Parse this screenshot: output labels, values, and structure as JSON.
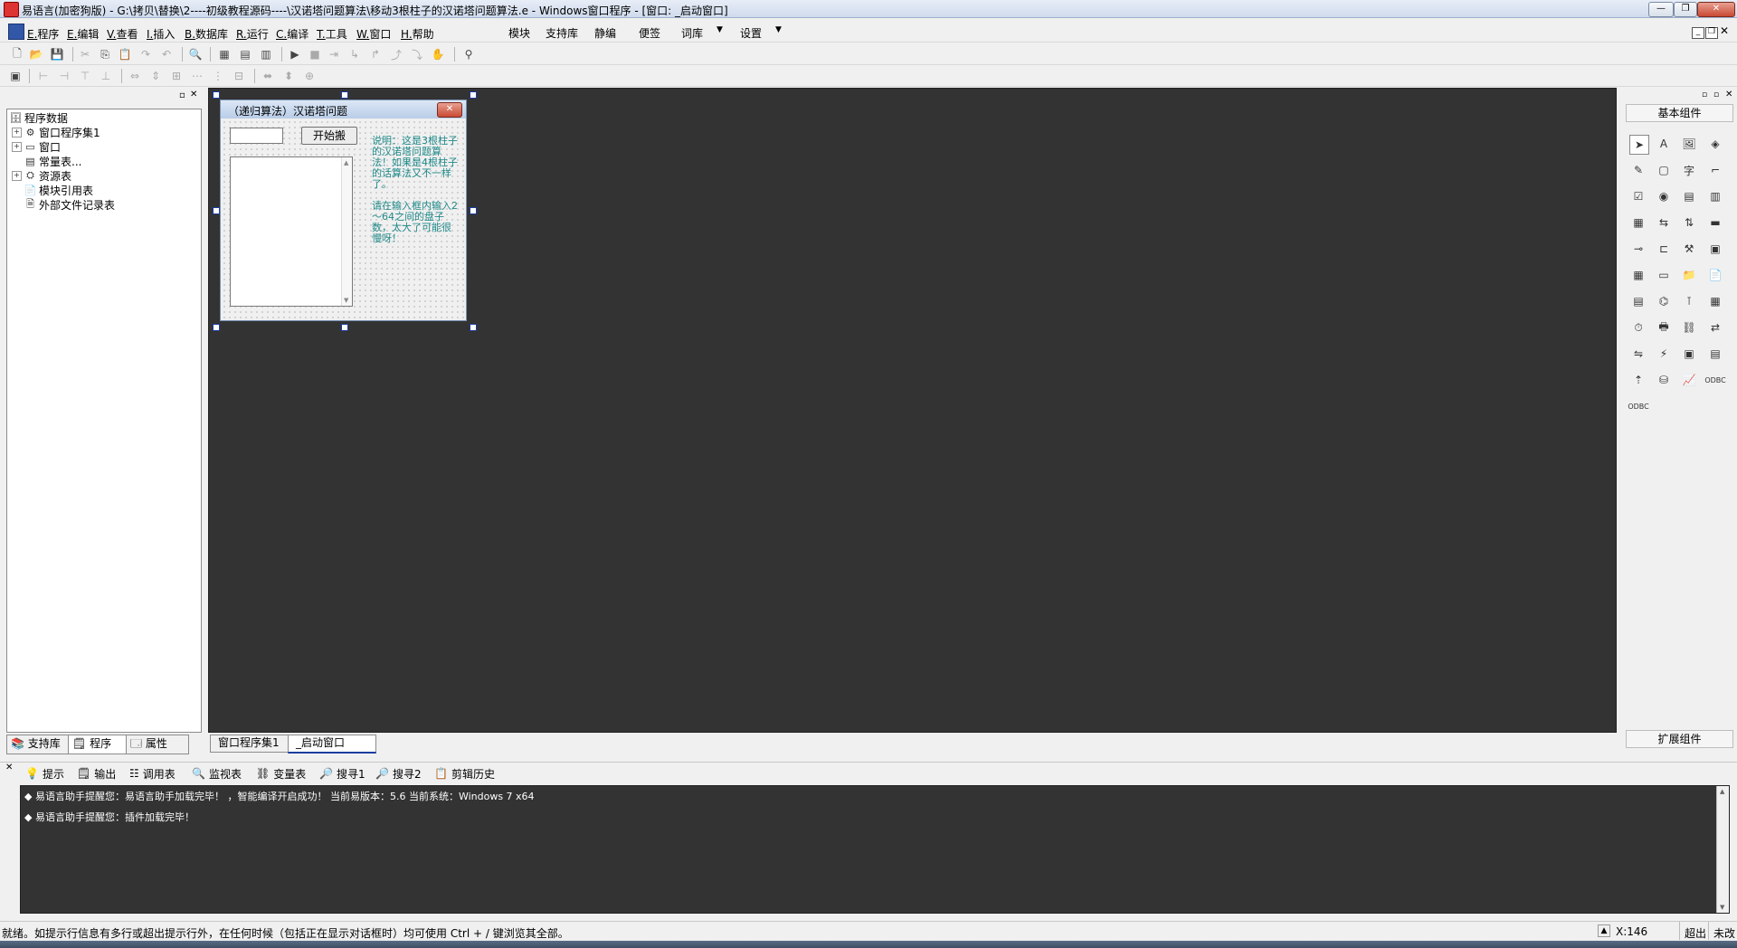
{
  "window": {
    "title": "易语言(加密狗版) - G:\\拷贝\\替换\\2----初级教程源码----\\汉诺塔问题算法\\移动3根柱子的汉诺塔问题算法.e - Windows窗口程序 - [窗口: _启动窗口]",
    "min_label": "—",
    "max_label": "❐",
    "close_label": "✕"
  },
  "menubar": {
    "items": [
      {
        "key": "E.",
        "label": "程序"
      },
      {
        "key": "E.",
        "label": "编辑"
      },
      {
        "key": "V.",
        "label": "查看"
      },
      {
        "key": "I.",
        "label": "插入"
      },
      {
        "key": "B.",
        "label": "数据库"
      },
      {
        "key": "R.",
        "label": "运行"
      },
      {
        "key": "C.",
        "label": "编译"
      },
      {
        "key": "T.",
        "label": "工具"
      },
      {
        "key": "W.",
        "label": "窗口"
      },
      {
        "key": "H.",
        "label": "帮助"
      }
    ],
    "extras": [
      "模块",
      "支持库",
      "静编",
      "便签",
      "词库",
      "设置"
    ]
  },
  "tree": {
    "root": "程序数据",
    "items": [
      "窗口程序集1",
      "窗口",
      "常量表...",
      "资源表",
      "模块引用表",
      "外部文件记录表"
    ]
  },
  "left_tabs": [
    "支持库",
    "程序",
    "属性"
  ],
  "form": {
    "title": "（递归算法）汉诺塔问题",
    "button_label": "开始搬",
    "desc1": "说明：这是3根柱子的汉诺塔问题算法！如果是4根柱子的话算法又不一样了。",
    "desc2": "请在输入框内输入2～64之间的盘子数，太大了可能很慢呀！"
  },
  "doc_tabs": [
    "窗口程序集1",
    "_启动窗口"
  ],
  "right_panel": {
    "header": "基本组件",
    "footer": "扩展组件"
  },
  "output_tabs": [
    "提示",
    "输出",
    "调用表",
    "监视表",
    "变量表",
    "搜寻1",
    "搜寻2",
    "剪辑历史"
  ],
  "messages": [
    "易语言助手提醒您：易语言助手加载完毕！ ，智能编译开启成功！ 当前易版本：5.6  当前系统：Windows 7 x64",
    "易语言助手提醒您：插件加载完毕！"
  ],
  "status": {
    "text": "就绪。如提示行信息有多行或超出提示行外，在任何时候（包括正在显示对话框时）均可使用 Ctrl + / 键浏览其全部。",
    "coord": "X:146",
    "mode": "超出",
    "state": "未改"
  }
}
